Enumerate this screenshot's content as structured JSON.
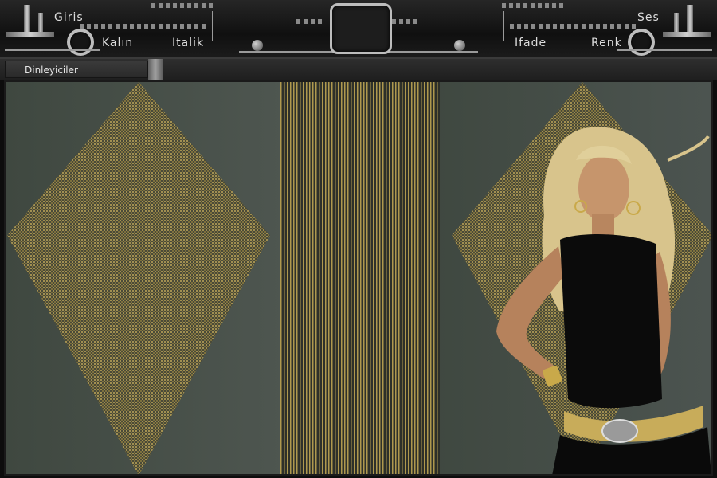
{
  "toolbar": {
    "login_label": "Giris",
    "sound_label": "Ses",
    "bold_label": "Kalın",
    "italic_label": "Italik",
    "emoticon_label": "Ifade",
    "color_label": "Renk"
  },
  "tabs": {
    "listeners_label": "Dinleyiciler"
  },
  "colors": {
    "toolbar_bg": "#151515",
    "content_bg": "#4b534d",
    "mesh_gold": "#b8a257",
    "text": "#dcdcdc"
  },
  "icons": [
    "knob-left-icon",
    "knob-right-icon",
    "center-screen-icon"
  ]
}
